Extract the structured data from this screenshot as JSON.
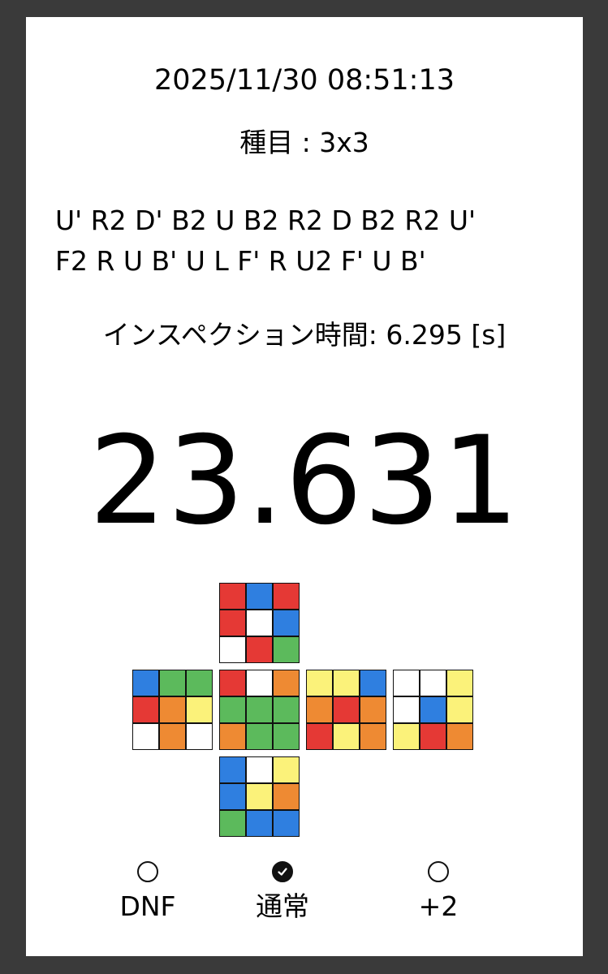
{
  "solve": {
    "datetime": "2025/11/30 08:51:13",
    "event": "種目 : 3x3",
    "scramble_lines": [
      "U' R2 D' B2 U B2 R2 D B2 R2 U'",
      "F2 R U B' U L F' R U2 F' U B'"
    ],
    "inspection": "インスペクション時間: 6.295 [s]",
    "time": "23.631"
  },
  "colors": {
    "W": "#ffffff",
    "R": "#e53935",
    "B": "#2f7fe0",
    "G": "#5cba5c",
    "O": "#ee8a33",
    "Y": "#fbf27a"
  },
  "cube_net": {
    "U": [
      "R",
      "B",
      "R",
      "R",
      "W",
      "B",
      "W",
      "R",
      "G"
    ],
    "L": [
      "B",
      "G",
      "G",
      "R",
      "O",
      "Y",
      "W",
      "O",
      "W"
    ],
    "F": [
      "R",
      "W",
      "O",
      "G",
      "G",
      "G",
      "O",
      "G",
      "G"
    ],
    "R": [
      "Y",
      "Y",
      "B",
      "O",
      "R",
      "O",
      "R",
      "Y",
      "O"
    ],
    "B": [
      "W",
      "W",
      "Y",
      "W",
      "B",
      "Y",
      "Y",
      "R",
      "O"
    ],
    "D": [
      "B",
      "W",
      "Y",
      "B",
      "Y",
      "O",
      "G",
      "B",
      "B"
    ]
  },
  "penalties": {
    "dnf": {
      "label": "DNF",
      "selected": false
    },
    "normal": {
      "label": "通常",
      "selected": true
    },
    "plus2": {
      "label": "+2",
      "selected": false
    }
  }
}
